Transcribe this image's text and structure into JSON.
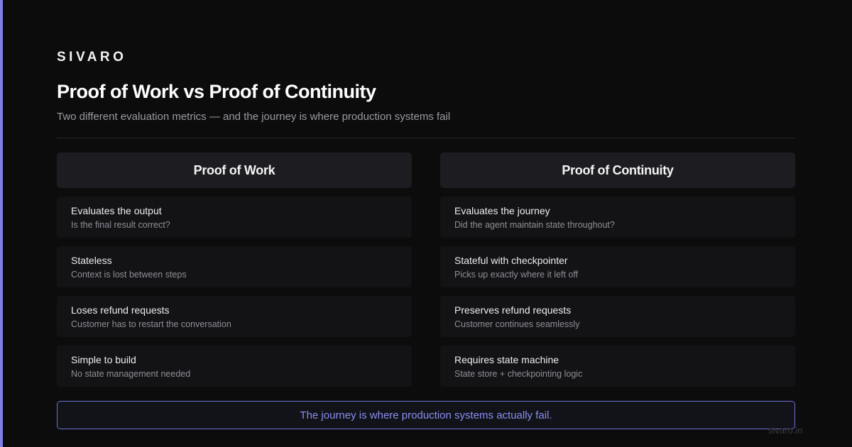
{
  "brand": "SIVARO",
  "title": "Proof of Work vs Proof of Continuity",
  "subtitle": "Two different evaluation metrics — and the journey is where production systems fail",
  "columns": [
    {
      "heading": "Proof of Work",
      "items": [
        {
          "title": "Evaluates the output",
          "desc": "Is the final result correct?"
        },
        {
          "title": "Stateless",
          "desc": "Context is lost between steps"
        },
        {
          "title": "Loses refund requests",
          "desc": "Customer has to restart the conversation"
        },
        {
          "title": "Simple to build",
          "desc": "No state management needed"
        }
      ]
    },
    {
      "heading": "Proof of Continuity",
      "items": [
        {
          "title": "Evaluates the journey",
          "desc": "Did the agent maintain state throughout?"
        },
        {
          "title": "Stateful with checkpointer",
          "desc": "Picks up exactly where it left off"
        },
        {
          "title": "Preserves refund requests",
          "desc": "Customer continues seamlessly"
        },
        {
          "title": "Requires state machine",
          "desc": "State store + checkpointing logic"
        }
      ]
    }
  ],
  "callout": "The journey is where production systems actually fail.",
  "footer": "sivaro.in",
  "colors": {
    "accent": "#7b7fe6",
    "background": "#0c0c0d",
    "callout_text": "#8c8ff0"
  }
}
